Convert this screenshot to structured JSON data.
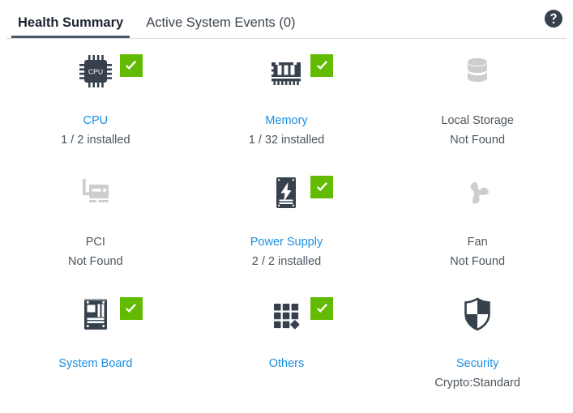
{
  "colors": {
    "accent_link": "#1A8FE3",
    "status_ok_green": "#62BB00",
    "icon_dark": "#36414D",
    "icon_disabled_gray": "#CDCDCD",
    "tab_underline": "#46596B",
    "text_default": "#4C555E"
  },
  "header": {
    "tabs": [
      {
        "label": "Health Summary",
        "active": true
      },
      {
        "label": "Active System Events (0)",
        "active": false
      }
    ],
    "help_icon": "help-circle-icon",
    "help_glyph": "?"
  },
  "health_items": [
    {
      "name": "CPU",
      "icon": "cpu-chip-icon",
      "status_text": "1 / 2 installed",
      "has_check_badge": true,
      "is_link": true,
      "enabled": true
    },
    {
      "name": "Memory",
      "icon": "memory-dimm-icon",
      "status_text": "1 / 32 installed",
      "has_check_badge": true,
      "is_link": true,
      "enabled": true
    },
    {
      "name": "Local Storage",
      "icon": "database-storage-icon",
      "status_text": "Not Found",
      "has_check_badge": false,
      "is_link": false,
      "enabled": false
    },
    {
      "name": "PCI",
      "icon": "pci-card-icon",
      "status_text": "Not Found",
      "has_check_badge": false,
      "is_link": false,
      "enabled": false
    },
    {
      "name": "Power Supply",
      "icon": "power-supply-icon",
      "status_text": "2 / 2 installed",
      "has_check_badge": true,
      "is_link": true,
      "enabled": true
    },
    {
      "name": "Fan",
      "icon": "fan-icon",
      "status_text": "Not Found",
      "has_check_badge": false,
      "is_link": false,
      "enabled": false
    },
    {
      "name": "System Board",
      "icon": "system-board-icon",
      "status_text": "",
      "has_check_badge": true,
      "is_link": true,
      "enabled": true
    },
    {
      "name": "Others",
      "icon": "others-grid-icon",
      "status_text": "",
      "has_check_badge": true,
      "is_link": true,
      "enabled": true
    },
    {
      "name": "Security",
      "icon": "shield-security-icon",
      "status_text": "Crypto:Standard",
      "has_check_badge": false,
      "is_link": true,
      "enabled": true
    }
  ]
}
